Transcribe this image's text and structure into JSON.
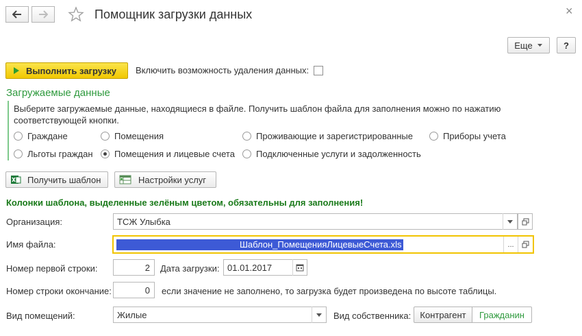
{
  "window": {
    "title": "Помощник загрузки данных",
    "close_glyph": "×"
  },
  "toolbar": {
    "more_label": "Еще",
    "help_label": "?",
    "run_label": "Выполнить загрузку",
    "delete_option_label": "Включить возможность удаления данных:",
    "delete_option_checked": false
  },
  "section": {
    "title": "Загружаемые данные",
    "description": "Выберите загружаемые данные, находящиеся в файле. Получить шаблон файла для заполнения можно по нажатию соответствующей кнопки."
  },
  "radios": [
    {
      "label": "Граждане",
      "selected": false
    },
    {
      "label": "Помещения",
      "selected": false
    },
    {
      "label": "Проживающие и зарегистрированные",
      "selected": false
    },
    {
      "label": "Приборы учета",
      "selected": false
    },
    {
      "label": "Льготы граждан",
      "selected": false
    },
    {
      "label": "Помещения и лицевые счета",
      "selected": true
    },
    {
      "label": "Подключенные услуги и задолженность",
      "selected": false
    }
  ],
  "buttons": {
    "get_template": "Получить шаблон",
    "service_settings": "Настройки услуг"
  },
  "note": "Колонки шаблона, выделенные зелёным цветом, обязательны для заполнения!",
  "form": {
    "organization_label": "Организация:",
    "organization_value": "ТСЖ Улыбка",
    "filename_label": "Имя файла:",
    "filename_value": "Шаблон_ПомещенияЛицевыеСчета.xls",
    "first_row_label": "Номер первой строки:",
    "first_row_value": "2",
    "load_date_label": "Дата загрузки:",
    "load_date_value": "01.01.2017",
    "end_row_label": "Номер строки окончание:",
    "end_row_value": "0",
    "end_row_hint": "если значение не заполнено, то загрузка будет произведена по высоте таблицы.",
    "premises_type_label": "Вид помещений:",
    "premises_type_value": "Жилые",
    "owner_type_label": "Вид собственника:",
    "owner_options": [
      "Контрагент",
      "Гражданин"
    ],
    "owner_selected": "Гражданин",
    "ellipsis": "..."
  },
  "colors": {
    "accent_green": "#2f9a3e",
    "note_green": "#1a7a1a",
    "primary_yellow": "#f5d20a",
    "focus_border": "#f1c400",
    "selection_blue": "#3d5ad6"
  },
  "icons": [
    "back-arrow-icon",
    "forward-arrow-icon",
    "star-icon",
    "close-icon",
    "play-icon",
    "excel-icon",
    "settings-table-icon",
    "dropdown-arrow-icon",
    "open-window-icon",
    "calendar-icon"
  ]
}
